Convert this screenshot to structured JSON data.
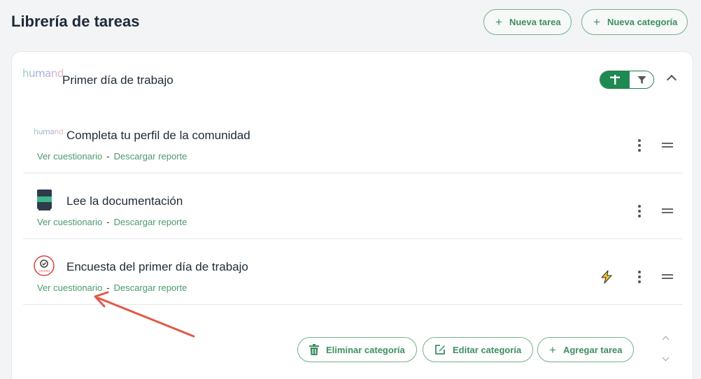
{
  "page": {
    "title": "Librería de tareas"
  },
  "header": {
    "new_task": "Nueva tarea",
    "new_category": "Nueva categoría"
  },
  "category": {
    "logo_text": "humand",
    "title": "Primer día de trabajo",
    "toggle_on_icon": "plus-icon",
    "toggle_off_icon": "filter-icon"
  },
  "tasks": [
    {
      "title": "Completa tu perfil de la comunidad",
      "icon": "humand-logo",
      "logo_text": "humand",
      "link_questionnaire": "Ver cuestionario",
      "separator": "-",
      "link_report": "Descargar reporte",
      "automated": false
    },
    {
      "title": "Lee la documentación",
      "icon": "book-icon",
      "link_questionnaire": "Ver cuestionario",
      "separator": "-",
      "link_report": "Descargar reporte",
      "automated": false
    },
    {
      "title": "Encuesta del primer día de trabajo",
      "icon": "quality-badge-icon",
      "badge_text": "CALIDAD",
      "link_questionnaire": "Ver cuestionario",
      "separator": "-",
      "link_report": "Descargar reporte",
      "automated": true
    }
  ],
  "footer": {
    "delete_category": "Eliminar categoría",
    "edit_category": "Editar categoría",
    "add_task": "Agregar tarea"
  },
  "colors": {
    "accent": "#3e8f60",
    "toggle_on": "#1e8a52",
    "annotation_arrow": "#e05a47",
    "bolt": "#f2c230"
  }
}
